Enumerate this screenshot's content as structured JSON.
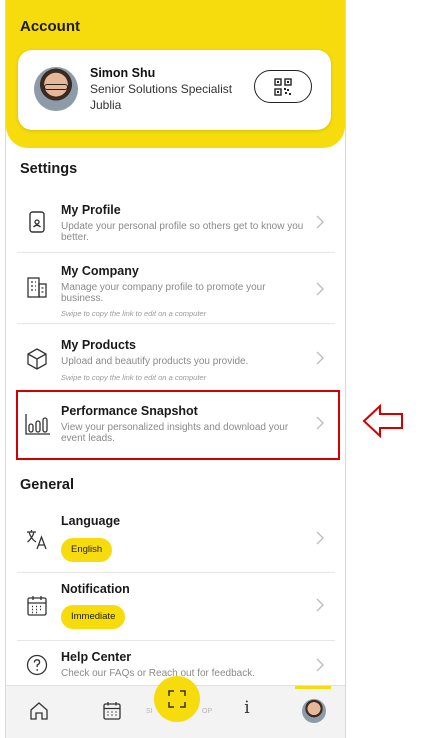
{
  "account": {
    "title": "Account",
    "user": {
      "name": "Simon Shu",
      "role": "Senior Solutions Specialist",
      "company": "Jublia"
    }
  },
  "settings": {
    "title": "Settings",
    "items": [
      {
        "title": "My Profile",
        "desc": "Update your personal profile so others get to know you better.",
        "icon": "phone-profile-icon"
      },
      {
        "title": "My Company",
        "desc": "Manage your company profile to promote your business.",
        "hint": "Swipe to copy the link to edit on a computer",
        "icon": "building-icon"
      },
      {
        "title": "My Products",
        "desc": "Upload and beautify products you provide.",
        "hint": "Swipe to copy the link to edit on a computer",
        "icon": "cube-icon"
      },
      {
        "title": "Performance Snapshot",
        "desc": "View your personalized insights and download your event leads.",
        "icon": "bar-chart-icon"
      }
    ]
  },
  "general": {
    "title": "General",
    "items": [
      {
        "title": "Language",
        "pill": "English",
        "icon": "translate-icon"
      },
      {
        "title": "Notification",
        "pill": "Immediate",
        "icon": "calendar-icon"
      },
      {
        "title": "Help Center",
        "desc": "Check our FAQs or Reach out for feedback.",
        "icon": "help-icon"
      }
    ]
  },
  "bottom_nav": {
    "faded_left": "SI",
    "faded_right": "OP",
    "info_glyph": "i"
  },
  "colors": {
    "accent": "#f6dc0c",
    "highlight": "#d40000"
  }
}
